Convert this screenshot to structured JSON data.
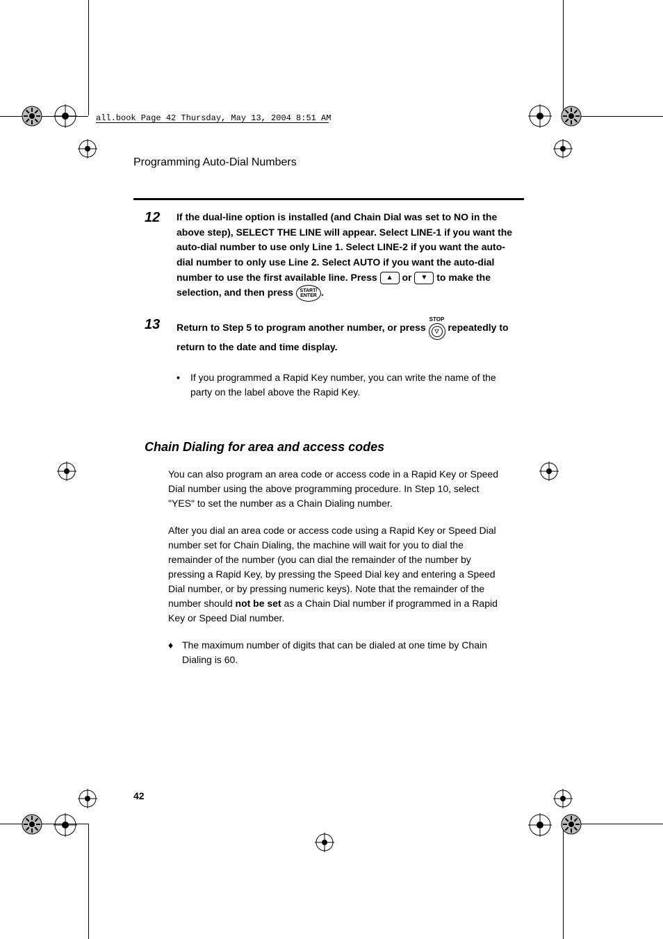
{
  "header_bar": "all.book  Page 42  Thursday, May 13, 2004  8:51 AM",
  "section_title": "Programming Auto-Dial Numbers",
  "step12": {
    "num": "12",
    "text_a": "If the dual-line option is installed (and Chain Dial was set to NO in the above step), SELECT THE LINE will appear. Select LINE-1 if you want the auto-dial number to use only Line 1. Select LINE-2 if you want the auto-dial number to only use Line 2. Select AUTO if you want the auto-dial number to use the first available line. Press ",
    "or": " or ",
    "text_b": " to make the selection, and then press ",
    "period": "."
  },
  "start_enter": {
    "l1": "START/",
    "l2": "ENTER"
  },
  "step13": {
    "num": "13",
    "text_a": "Return to Step 5 to program another number, or press ",
    "text_b": " repeatedly to return to the date and time display."
  },
  "stop_label": "STOP",
  "step13_sub": "If you programmed a Rapid Key number, you can write the name of the party on the label above the Rapid Key.",
  "h2": "Chain Dialing for area and access codes",
  "para1": "You can also program an area code or access code in a Rapid Key or Speed Dial number using the above programming procedure. In Step 10, select \"YES\" to set the number as a Chain Dialing number.",
  "para2_a": "After you dial an area code or access code using a Rapid Key or Speed Dial number set for Chain Dialing, the machine will wait for you to dial the remainder of the number (you can dial the remainder of the number by pressing a Rapid Key, by pressing the Speed Dial key and entering a Speed Dial number, or by pressing numeric keys). Note that the remainder of the number should ",
  "para2_bold": "not be set",
  "para2_b": " as a Chain Dial number if programmed in a Rapid Key or Speed Dial number.",
  "bullet1": "The maximum number of digits that can be dialed at one time by Chain Dialing is 60.",
  "page_number": "42"
}
